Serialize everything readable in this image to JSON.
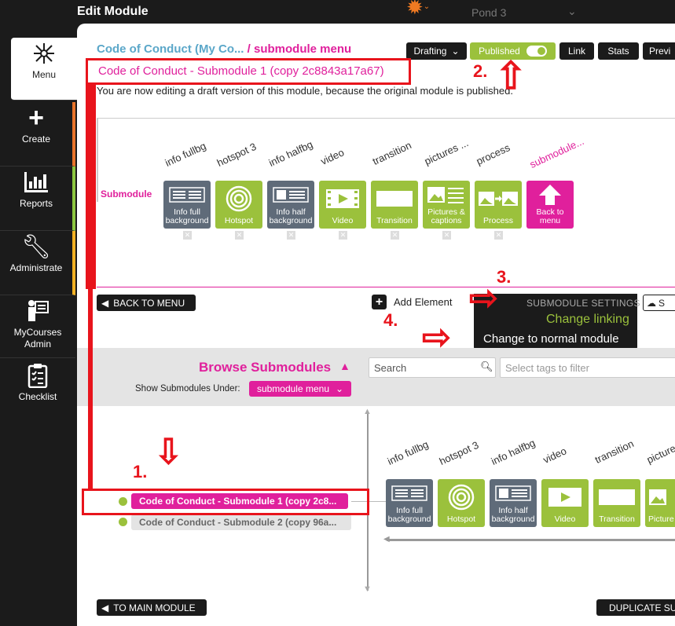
{
  "header": {
    "title": "Edit Module",
    "org": "Pond 3"
  },
  "sidebar": {
    "items": [
      {
        "label": "Menu"
      },
      {
        "label": "Create"
      },
      {
        "label": "Reports"
      },
      {
        "label": "Administrate"
      },
      {
        "label": "MyCourses Admin"
      },
      {
        "label": "Checklist"
      }
    ]
  },
  "breadcrumb": {
    "course": "Code of Conduct (My Co...",
    "sep": " / ",
    "menu": "submodule menu"
  },
  "module_name": "Code of Conduct - Submodule 1 (copy 2c8843a17a67)",
  "draft_note": "You are now editing a draft version of this module, because the original module is published.",
  "toolbar": {
    "drafting": "Drafting",
    "published": "Published",
    "link": "Link",
    "stats": "Stats",
    "preview": "Previ"
  },
  "canvas": {
    "submodule_label": "Submodule",
    "element_titles": [
      "info fullbg",
      "hotspot 3",
      "info halfbg",
      "video",
      "transition",
      "pictures ...",
      "process",
      "submodule..."
    ],
    "tiles": [
      "Info full background",
      "Hotspot",
      "Info half background",
      "Video",
      "Transition",
      "Pictures & captions",
      "Process",
      "Back to menu"
    ]
  },
  "actions": {
    "back_to_menu": "BACK TO MENU",
    "add_element": "Add Element",
    "save": "S"
  },
  "submodule_settings": {
    "heading": "SUBMODULE SETTINGS",
    "change_linking": "Change linking",
    "change_normal": "Change to normal module"
  },
  "browse": {
    "title": "Browse Submodules",
    "show_under_label": "Show Submodules Under:",
    "show_under_value": "submodule menu",
    "search_placeholder": "Search",
    "tags_placeholder": "Select tags to filter",
    "submodules": [
      "Code of Conduct - Submodule 1 (copy 2c8...",
      "Code of Conduct - Submodule 2 (copy 96a..."
    ],
    "preview_titles": [
      "info fullbg",
      "hotspot 3",
      "info halfbg",
      "video",
      "transition",
      "picture"
    ],
    "preview_tiles": [
      "Info full background",
      "Hotspot",
      "Info half background",
      "Video",
      "Transition",
      "Picture caption"
    ]
  },
  "footer": {
    "to_main_module": "TO MAIN MODULE",
    "duplicate": "DUPLICATE SU"
  },
  "annotations": {
    "step1": "1.",
    "step2": "2.",
    "step3": "3.",
    "step4": "4."
  },
  "colors": {
    "magenta": "#e0209c",
    "green": "#9bc13c",
    "slate": "#5f6b79",
    "dark": "#1b1b1b",
    "annotation_red": "#e8141c"
  }
}
